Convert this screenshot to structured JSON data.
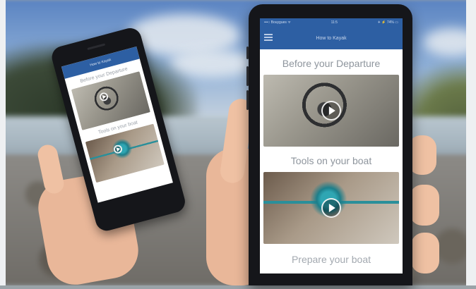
{
  "phone_right": {
    "status": {
      "carrier": "•••○ Bouygues ᯤ",
      "time": "11:5",
      "battery": "✈ ⚡ 74% ▭"
    },
    "nav_title": "How to Kayak",
    "sections": [
      {
        "title": "Before your Departure",
        "thumb": "ship-wheel"
      },
      {
        "title": "Tools on your boat",
        "thumb": "blue-rope-knot"
      },
      {
        "title": "Prepare your boat"
      }
    ]
  },
  "phone_left": {
    "nav_title": "How to Kayak",
    "sections": [
      {
        "title": "Before your Departure",
        "thumb": "ship-wheel"
      },
      {
        "title": "Tools on your boat",
        "thumb": "blue-rope-knot"
      }
    ]
  },
  "colors": {
    "nav_blue": "#2d5fa3",
    "section_title_gray": "#8e959d"
  }
}
